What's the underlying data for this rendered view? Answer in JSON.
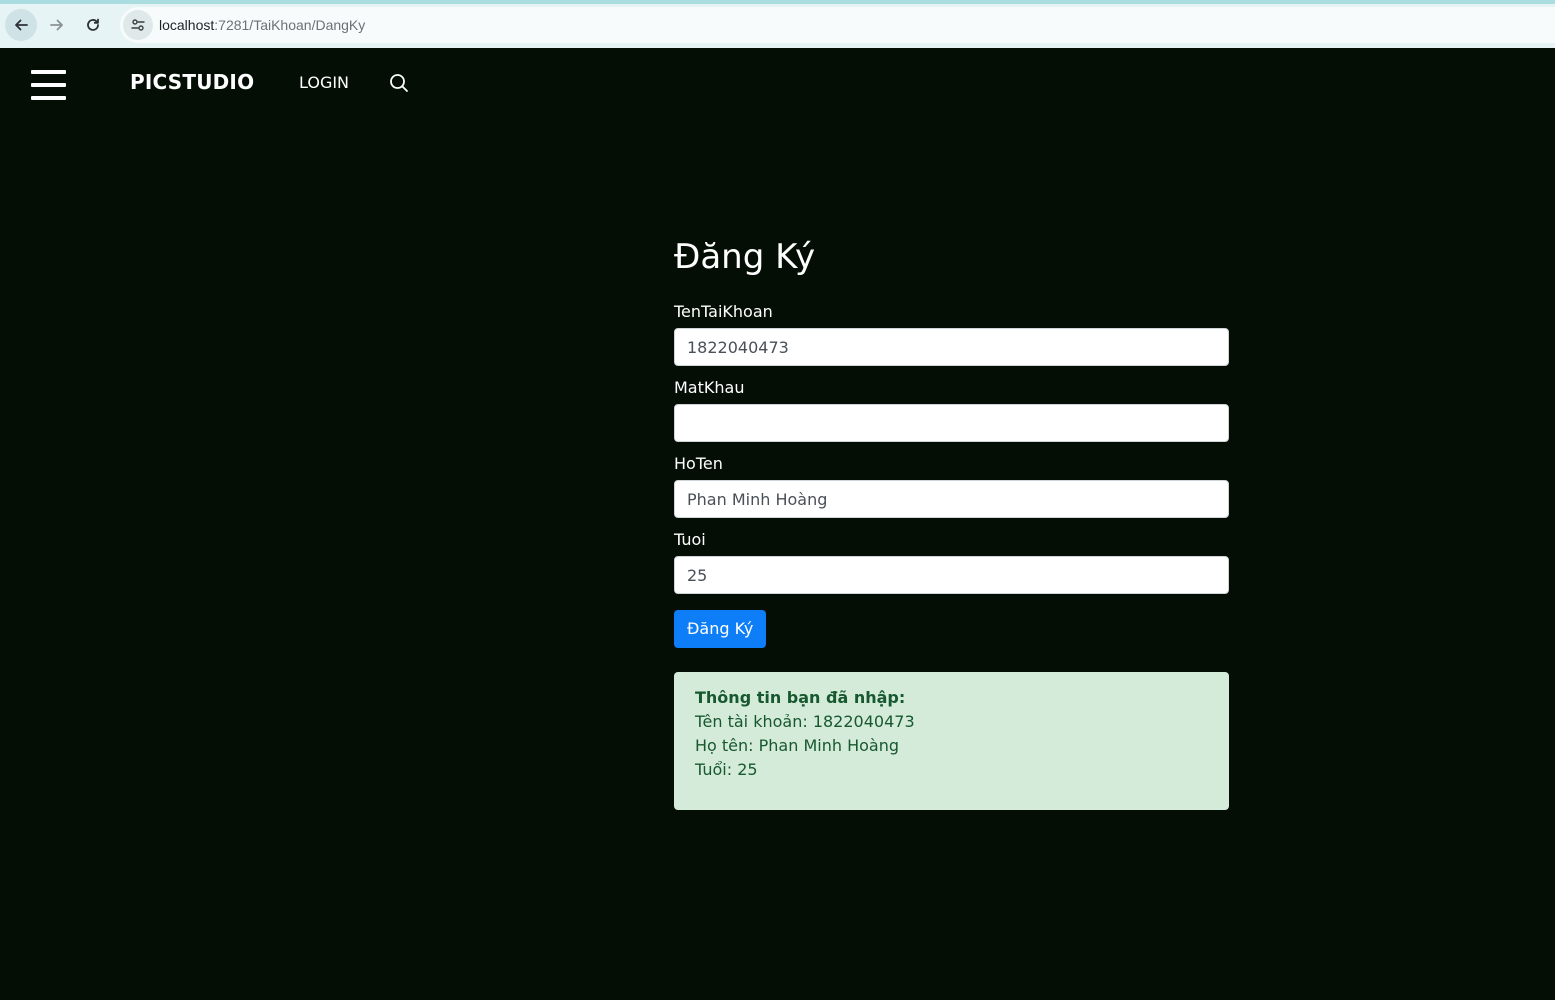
{
  "browser": {
    "url_host": "localhost",
    "url_path": ":7281/TaiKhoan/DangKy",
    "back_icon": "arrow-left-icon",
    "forward_icon": "arrow-right-icon",
    "reload_icon": "reload-icon",
    "site_info_icon": "tune-icon"
  },
  "header": {
    "brand": "PICSTUDIO",
    "nav_login": "LOGIN",
    "menu_icon": "hamburger-icon",
    "search_icon": "search-icon"
  },
  "form": {
    "title": "Đăng Ký",
    "fields": [
      {
        "label": "TenTaiKhoan",
        "value": "1822040473"
      },
      {
        "label": "MatKhau",
        "value": ""
      },
      {
        "label": "HoTen",
        "value": "Phan Minh Hoàng"
      },
      {
        "label": "Tuoi",
        "value": "25"
      }
    ],
    "submit_label": "Đăng Ký"
  },
  "result": {
    "title": "Thông tin bạn đã nhập:",
    "lines": [
      "Tên tài khoản: 1822040473",
      "Họ tên: Phan Minh Hoàng",
      "Tuổi: 25"
    ]
  },
  "colors": {
    "page_bg": "#040e05",
    "primary_button": "#0d7ef7",
    "success_bg": "#d4ebda",
    "success_text": "#17582f"
  }
}
